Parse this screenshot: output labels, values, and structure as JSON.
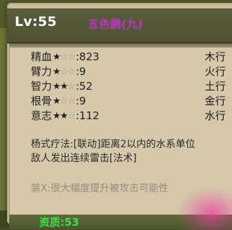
{
  "header": {
    "level": "Lv:55",
    "character_name": "五色鹊(九)"
  },
  "stats": [
    {
      "name": "精血",
      "stars_filled": 1,
      "stars_total": 3,
      "value": ":823",
      "element": "木行"
    },
    {
      "name": "臂力",
      "stars_filled": 1,
      "stars_total": 3,
      "value": ":9",
      "element": "火行"
    },
    {
      "name": "智力",
      "stars_filled": 2,
      "stars_total": 3,
      "value": ":52",
      "element": "土行"
    },
    {
      "name": "根骨",
      "stars_filled": 1,
      "stars_total": 3,
      "value": ":9",
      "element": "金行"
    },
    {
      "name": "意志",
      "stars_filled": 2,
      "stars_total": 3,
      "value": ":112",
      "element": "水行"
    }
  ],
  "skill": {
    "line1": "杨式疗法:[联动]距离2以内的水系单位",
    "line2": "敌人发出连续雷击[法术]"
  },
  "equip_note": "装X:很大幅度提升被攻击可能性",
  "bottom_label": "资质:53",
  "colors": {
    "level_text": "#ffffff",
    "name_text": "#c234c6",
    "bottom_text": "#38e34a",
    "pink_glow": "#e93ea0"
  },
  "icons": {
    "star_filled": "star-filled-icon",
    "star_empty": "star-empty-icon"
  }
}
